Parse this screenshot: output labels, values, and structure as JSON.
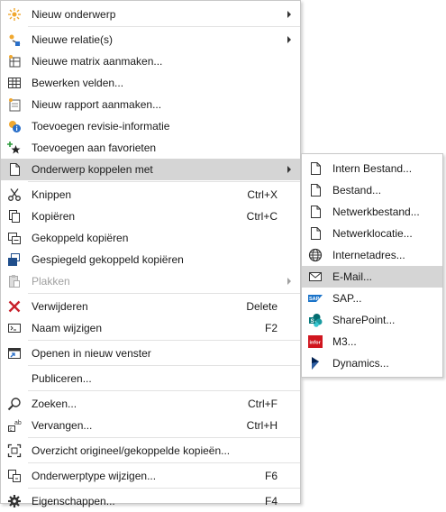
{
  "main_menu": {
    "items": [
      {
        "label": "Nieuw onderwerp",
        "icon": "sun-icon",
        "arrow": true
      },
      {
        "label": "Nieuwe relatie(s)",
        "icon": "relation-icon",
        "arrow": true
      },
      {
        "label": "Nieuwe matrix aanmaken...",
        "icon": "matrix-icon"
      },
      {
        "label": "Bewerken velden...",
        "icon": "table-icon"
      },
      {
        "label": "Nieuw rapport aanmaken...",
        "icon": "report-icon"
      },
      {
        "label": "Toevoegen revisie-informatie",
        "icon": "info-icon"
      },
      {
        "label": "Toevoegen aan favorieten",
        "icon": "star-icon"
      },
      {
        "label": "Onderwerp koppelen met",
        "icon": "document-icon",
        "arrow": true
      },
      {
        "label": "Knippen",
        "icon": "scissors-icon",
        "shortcut": "Ctrl+X"
      },
      {
        "label": "Kopiëren",
        "icon": "copy-icon",
        "shortcut": "Ctrl+C"
      },
      {
        "label": "Gekoppeld kopiëren",
        "icon": "linked-copy-icon"
      },
      {
        "label": "Gespiegeld gekoppeld kopiëren",
        "icon": "mirrored-copy-icon"
      },
      {
        "label": "Plakken",
        "icon": "paste-icon",
        "arrow": true
      },
      {
        "label": "Verwijderen",
        "icon": "delete-icon",
        "shortcut": "Delete"
      },
      {
        "label": "Naam wijzigen",
        "icon": "rename-icon",
        "shortcut": "F2"
      },
      {
        "label": "Openen in nieuw venster",
        "icon": "new-window-icon"
      },
      {
        "label": "Publiceren..."
      },
      {
        "label": "Zoeken...",
        "icon": "search-icon",
        "shortcut": "Ctrl+F"
      },
      {
        "label": "Vervangen...",
        "icon": "replace-icon",
        "shortcut": "Ctrl+H"
      },
      {
        "label": "Overzicht origineel/gekoppelde kopieën...",
        "icon": "overview-icon"
      },
      {
        "label": "Onderwerptype wijzigen...",
        "icon": "change-type-icon",
        "shortcut": "F6"
      },
      {
        "label": "Eigenschappen...",
        "icon": "gear-icon",
        "shortcut": "F4"
      }
    ]
  },
  "sub_menu": {
    "items": [
      {
        "label": "Intern Bestand...",
        "icon": "document-icon"
      },
      {
        "label": "Bestand...",
        "icon": "document-icon"
      },
      {
        "label": "Netwerkbestand...",
        "icon": "document-icon"
      },
      {
        "label": "Netwerklocatie...",
        "icon": "document-icon"
      },
      {
        "label": "Internetadres...",
        "icon": "globe-icon"
      },
      {
        "label": "E-Mail...",
        "icon": "mail-icon"
      },
      {
        "label": "SAP...",
        "icon": "sap-icon"
      },
      {
        "label": "SharePoint...",
        "icon": "sharepoint-icon"
      },
      {
        "label": "M3...",
        "icon": "infor-icon"
      },
      {
        "label": "Dynamics...",
        "icon": "dynamics-icon"
      }
    ]
  },
  "colors": {
    "highlight": "#d5d5d5",
    "disabled_text": "#a0a0a0",
    "separator": "#e2e2e2"
  }
}
